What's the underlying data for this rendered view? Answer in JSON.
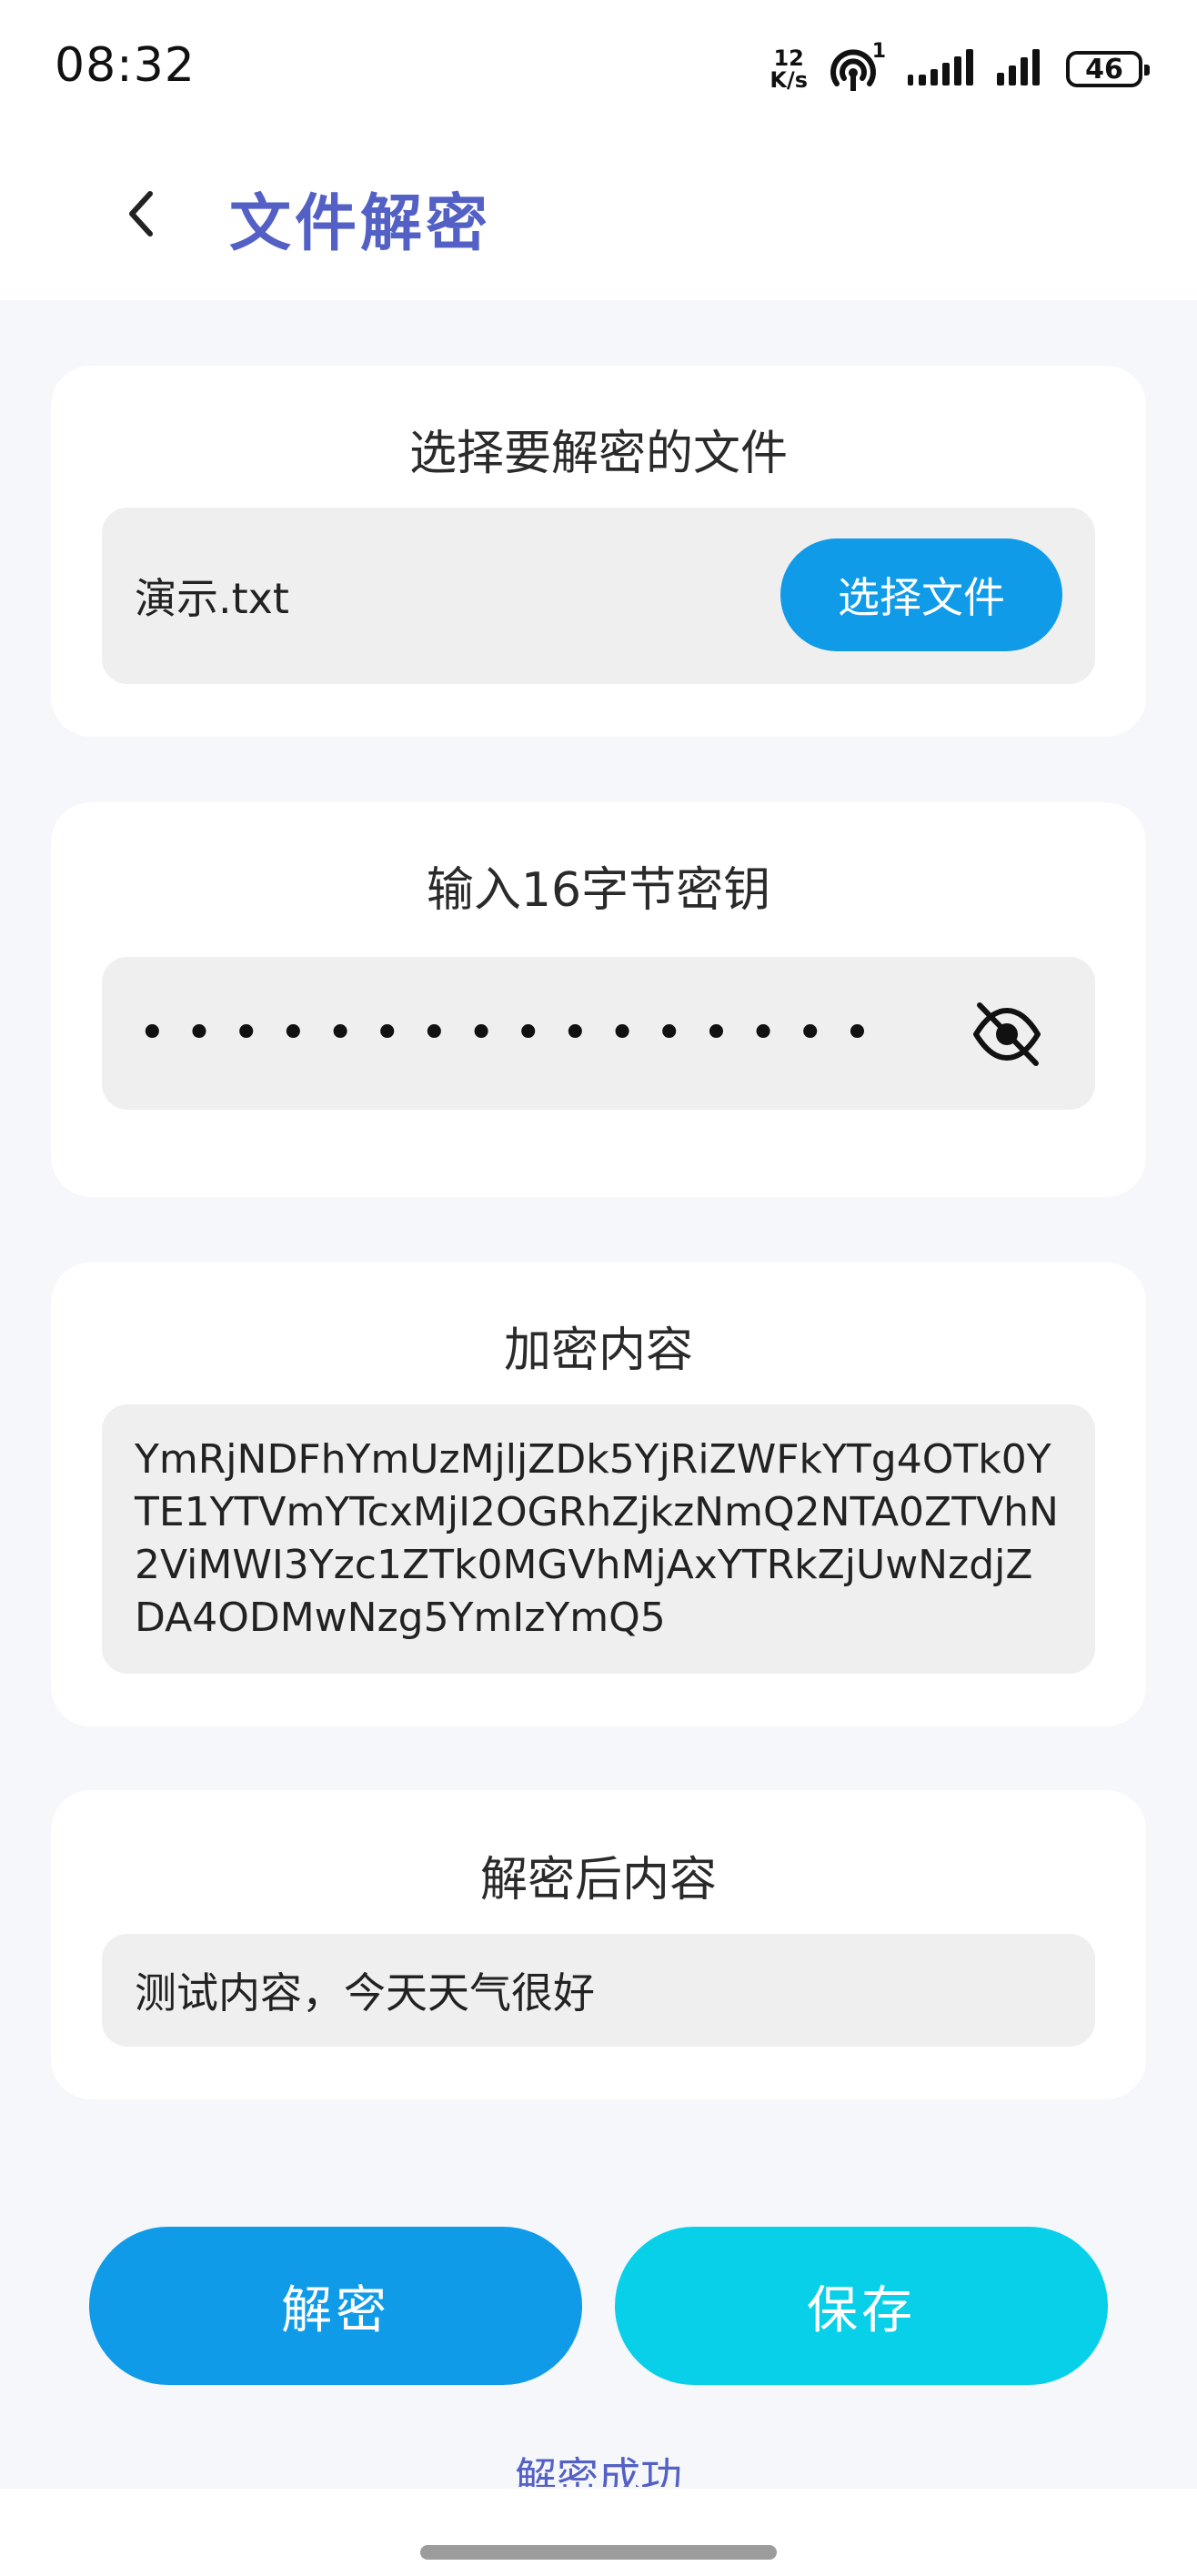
{
  "status_bar": {
    "time": "08:32",
    "net_speed_value": "12",
    "net_speed_unit": "K/s",
    "hotspot_badge": "1",
    "battery": "46"
  },
  "header": {
    "title": "文件解密"
  },
  "file_card": {
    "title": "选择要解密的文件",
    "file_name": "演示.txt",
    "choose_button": "选择文件"
  },
  "key_card": {
    "title": "输入16字节密钥",
    "masked_value": "••••••••••••••••"
  },
  "encrypted_card": {
    "title": "加密内容",
    "content": "YmRjNDFhYmUzMjljZDk5YjRiZWFkYTg4OTk0YTE1YTVmYTcxMjI2OGRhZjkzNmQ2NTA0ZTVhN2ViMWI3Yzc1ZTk0MGVhMjAxYTRkZjUwNzdjZDA4ODMwNzg5YmIzYmQ5"
  },
  "decrypted_card": {
    "title": "解密后内容",
    "content": "测试内容，今天天气很好"
  },
  "actions": {
    "decrypt_label": "解密",
    "save_label": "保存"
  },
  "result_message": "解密成功",
  "colors": {
    "accent_title": "#5360c5",
    "primary_button": "#0f9be8",
    "secondary_button": "#08d0e8"
  }
}
